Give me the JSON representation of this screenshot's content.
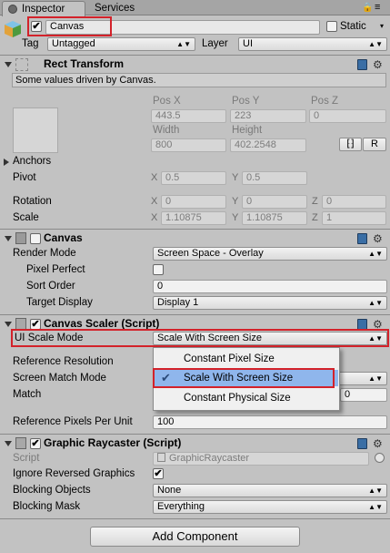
{
  "tabs": {
    "inspector": "Inspector",
    "services": "Services"
  },
  "header": {
    "object_name": "Canvas",
    "static_label": "Static",
    "tag_label": "Tag",
    "tag_value": "Untagged",
    "layer_label": "Layer",
    "layer_value": "UI"
  },
  "rect_transform": {
    "title": "Rect Transform",
    "info": "Some values driven by Canvas.",
    "pos_x_label": "Pos X",
    "pos_y_label": "Pos Y",
    "pos_z_label": "Pos Z",
    "pos_x": "443.5",
    "pos_y": "223",
    "pos_z": "0",
    "width_label": "Width",
    "height_label": "Height",
    "width": "800",
    "height": "402.2548",
    "r_label": "R",
    "anchors_label": "Anchors",
    "pivot_label": "Pivot",
    "pivot_x": "0.5",
    "pivot_y": "0.5",
    "rotation_label": "Rotation",
    "rot_x": "0",
    "rot_y": "0",
    "rot_z": "0",
    "scale_label": "Scale",
    "scale_x": "1.10875",
    "scale_y": "1.10875",
    "scale_z": "1",
    "x": "X",
    "y": "Y",
    "z": "Z"
  },
  "canvas": {
    "title": "Canvas",
    "render_mode_label": "Render Mode",
    "render_mode": "Screen Space - Overlay",
    "pixel_perfect_label": "Pixel Perfect",
    "sort_order_label": "Sort Order",
    "sort_order": "0",
    "target_display_label": "Target Display",
    "target_display": "Display 1"
  },
  "canvas_scaler": {
    "title": "Canvas Scaler (Script)",
    "ui_scale_mode_label": "UI Scale Mode",
    "ui_scale_mode": "Scale With Screen Size",
    "reference_resolution_label": "Reference Resolution",
    "screen_match_mode_label": "Screen Match Mode",
    "match_label": "Match",
    "match_value": "0",
    "ref_pixels_label": "Reference Pixels Per Unit",
    "ref_pixels": "100"
  },
  "dropdown": {
    "options": [
      "Constant Pixel Size",
      "Scale With Screen Size",
      "Constant Physical Size"
    ],
    "selected_index": 1
  },
  "graphic_raycaster": {
    "title": "Graphic Raycaster (Script)",
    "script_label": "Script",
    "script_value": "GraphicRaycaster",
    "ignore_reversed_label": "Ignore Reversed Graphics",
    "blocking_objects_label": "Blocking Objects",
    "blocking_objects": "None",
    "blocking_mask_label": "Blocking Mask",
    "blocking_mask": "Everything"
  },
  "footer": {
    "add_component": "Add Component"
  },
  "colors": {
    "highlight_red": "#d3222a",
    "selection_blue": "#8fb6ec",
    "panel_bg": "#c2c2c2"
  }
}
